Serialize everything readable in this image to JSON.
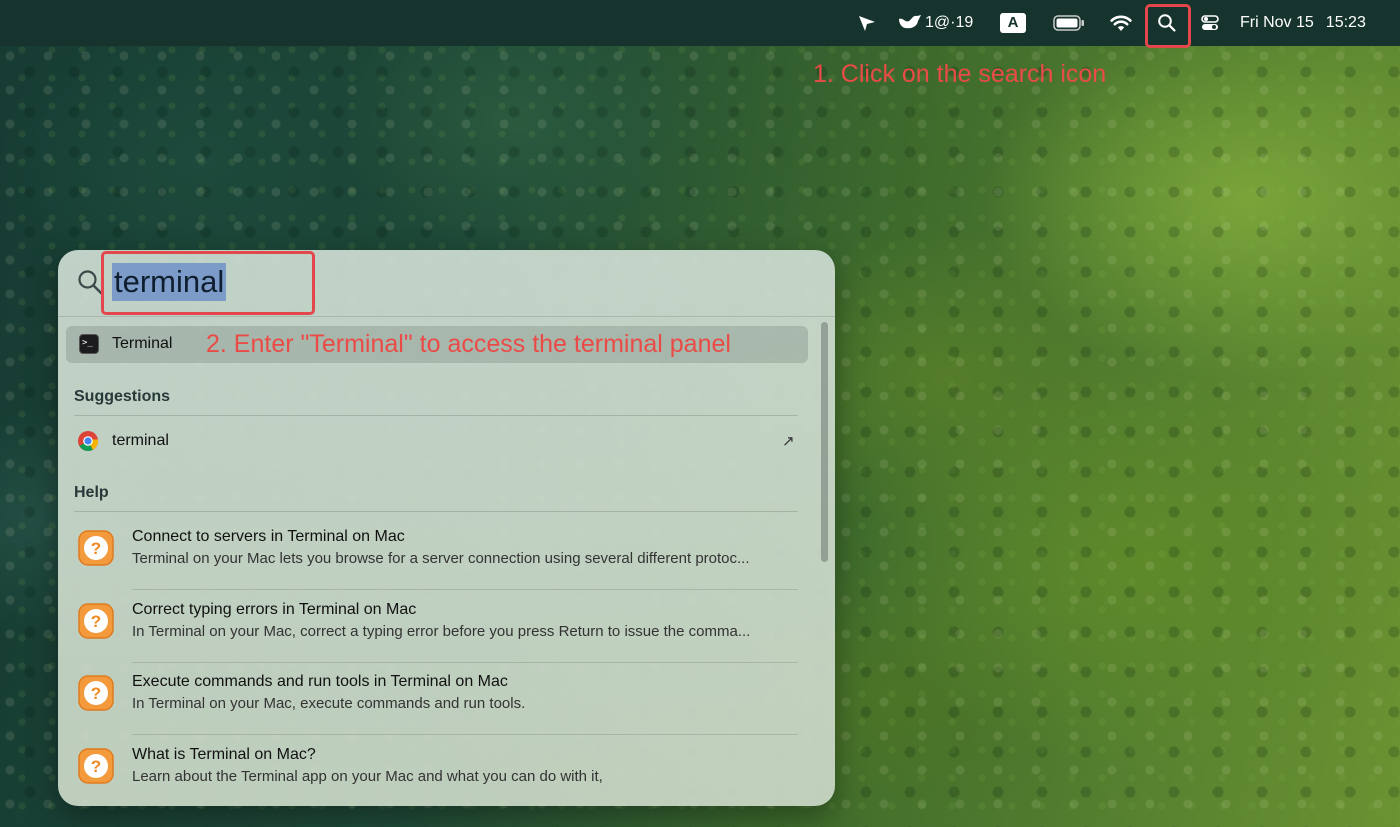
{
  "menubar": {
    "status_text": "1@·19",
    "input_source": "A",
    "date": "Fri Nov 15",
    "time": "15:23",
    "icons": [
      "send-icon",
      "cloud-status-icon",
      "input-source-icon",
      "battery-icon",
      "wifi-icon",
      "spotlight-search-icon",
      "control-center-icon"
    ]
  },
  "annotations": {
    "step1": "1. Click on the search icon",
    "step2": "2. Enter \"Terminal\" to access the terminal panel",
    "highlight_color": "#e3474b"
  },
  "spotlight": {
    "query": "terminal",
    "top_hit": {
      "label": "Terminal",
      "icon": "terminal-app-icon"
    },
    "suggestions_title": "Suggestions",
    "suggestion": {
      "label": "terminal",
      "icon": "chrome-icon",
      "action_icon": "↗"
    },
    "help_title": "Help",
    "help_items": [
      {
        "title": "Connect to servers in Terminal on Mac",
        "desc": "Terminal on your Mac lets you browse for a server connection using several different protoc..."
      },
      {
        "title": "Correct typing errors in Terminal on Mac",
        "desc": "In Terminal on your Mac, correct a typing error before you press Return to issue the comma..."
      },
      {
        "title": "Execute commands and run tools in Terminal on Mac",
        "desc": "In Terminal on your Mac, execute commands and run tools."
      },
      {
        "title": "What is Terminal on Mac?",
        "desc": "Learn about the Terminal app on your Mac and what you can do with it,"
      }
    ]
  }
}
